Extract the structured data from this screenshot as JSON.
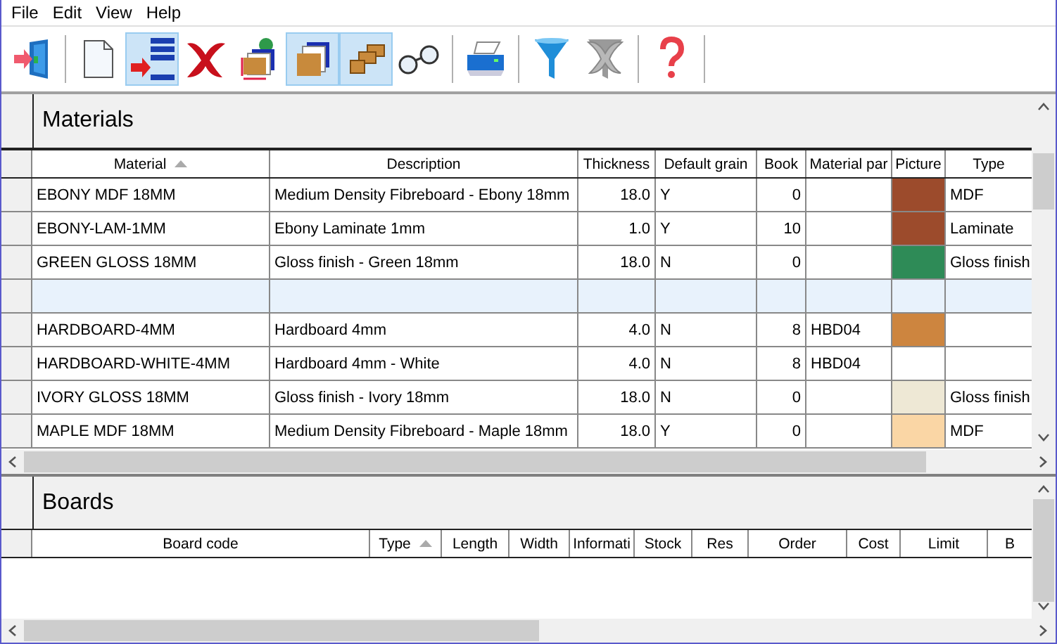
{
  "menu": [
    "File",
    "Edit",
    "View",
    "Help"
  ],
  "toolbar": [
    {
      "buttons": [
        {
          "kind": "exit",
          "active": false
        }
      ]
    },
    {
      "buttons": [
        {
          "kind": "new",
          "active": false
        },
        {
          "kind": "insert",
          "active": true
        },
        {
          "kind": "delete",
          "active": false
        },
        {
          "kind": "boards",
          "active": false
        },
        {
          "kind": "sheets",
          "active": true
        },
        {
          "kind": "offcuts",
          "active": true
        },
        {
          "kind": "view",
          "active": false
        }
      ]
    },
    {
      "buttons": [
        {
          "kind": "print",
          "active": false
        }
      ]
    },
    {
      "buttons": [
        {
          "kind": "filter",
          "active": false
        },
        {
          "kind": "clear",
          "active": false
        }
      ]
    },
    {
      "buttons": [
        {
          "kind": "help",
          "active": false
        }
      ]
    }
  ],
  "materials": {
    "title": "Materials",
    "columns": [
      {
        "label": "Material",
        "sorted": true
      },
      {
        "label": "Description",
        "sorted": false
      },
      {
        "label": "Thickness",
        "sorted": false
      },
      {
        "label": "Default grain",
        "sorted": false
      },
      {
        "label": "Book",
        "sorted": false
      },
      {
        "label": "Material par",
        "sorted": false
      },
      {
        "label": "Picture",
        "sorted": false
      },
      {
        "label": "Type",
        "sorted": false
      }
    ],
    "rows": [
      {
        "selected": false,
        "cells": [
          "EBONY MDF 18MM",
          "Medium Density Fibreboard - Ebony 18mm",
          "18.0",
          "Y",
          "0",
          "",
          "",
          "MDF"
        ],
        "color": "#9c4b2c"
      },
      {
        "selected": false,
        "cells": [
          "EBONY-LAM-1MM",
          "Ebony Laminate 1mm",
          "1.0",
          "Y",
          "10",
          "",
          "",
          "Laminate"
        ],
        "color": "#9c4b2c"
      },
      {
        "selected": false,
        "cells": [
          "GREEN GLOSS 18MM",
          "Gloss finish - Green 18mm",
          "18.0",
          "N",
          "0",
          "",
          "",
          "Gloss finish"
        ],
        "color": "#2e8b57"
      },
      {
        "selected": true,
        "cells": [
          "",
          "",
          "",
          "",
          "",
          "",
          "",
          ""
        ]
      },
      {
        "selected": false,
        "cells": [
          "HARDBOARD-4MM",
          "Hardboard 4mm",
          "4.0",
          "N",
          "8",
          "HBD04",
          "",
          ""
        ],
        "color": "#cd853f"
      },
      {
        "selected": false,
        "cells": [
          "HARDBOARD-WHITE-4MM",
          "Hardboard 4mm - White",
          "4.0",
          "N",
          "8",
          "HBD04",
          "",
          ""
        ]
      },
      {
        "selected": false,
        "cells": [
          "IVORY GLOSS 18MM",
          "Gloss finish - Ivory 18mm",
          "18.0",
          "N",
          "0",
          "",
          "",
          "Gloss finish"
        ],
        "color": "#eee8d5"
      },
      {
        "selected": false,
        "cells": [
          "MAPLE MDF 18MM",
          "Medium Density Fibreboard - Maple 18mm",
          "18.0",
          "Y",
          "0",
          "",
          "",
          "MDF"
        ],
        "color": "#fad6a5"
      }
    ]
  },
  "boards": {
    "title": "Boards",
    "columns": [
      {
        "label": "Board code",
        "sorted": false
      },
      {
        "label": "Type",
        "sorted": true
      },
      {
        "label": "Length",
        "sorted": false
      },
      {
        "label": "Width",
        "sorted": false
      },
      {
        "label": "Informati",
        "sorted": false
      },
      {
        "label": "Stock",
        "sorted": false
      },
      {
        "label": "Res",
        "sorted": false
      },
      {
        "label": "Order",
        "sorted": false
      },
      {
        "label": "Cost",
        "sorted": false
      },
      {
        "label": "Limit",
        "sorted": false
      },
      {
        "label": "B",
        "sorted": false
      }
    ]
  }
}
